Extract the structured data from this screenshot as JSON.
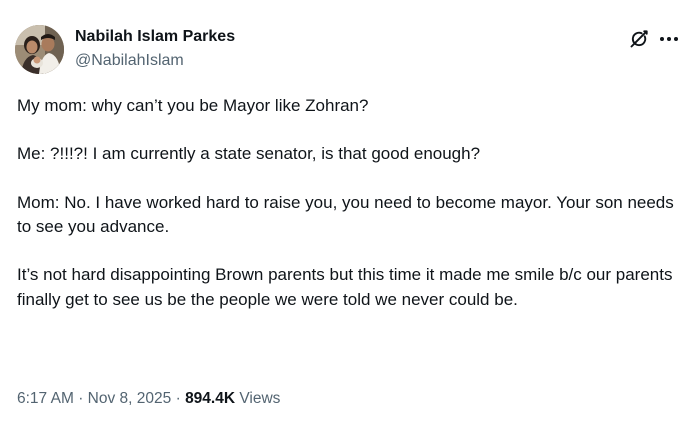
{
  "author": {
    "display_name": "Nabilah Islam Parkes",
    "handle": "@NabilahIslam"
  },
  "actions": {
    "grok_icon": "grok-icon",
    "more_icon": "more-icon"
  },
  "tweet": {
    "paragraphs": [
      "My mom: why can’t you be Mayor like Zohran?",
      "Me: ?!!!?! I am currently a state senator, is that good enough?",
      "Mom: No. I have worked hard to raise you, you need to become mayor. Your son needs to see you advance.",
      "It’s not hard disappointing Brown parents but this time it made me smile b/c our parents finally get to see us be the people we were told we never could be."
    ]
  },
  "meta": {
    "time": "6:17 AM",
    "separator": "·",
    "date": "Nov 8, 2025",
    "views_count": "894.4K",
    "views_label": "Views"
  },
  "colors": {
    "text": "#0f1419",
    "secondary": "#536471",
    "background": "#ffffff"
  }
}
